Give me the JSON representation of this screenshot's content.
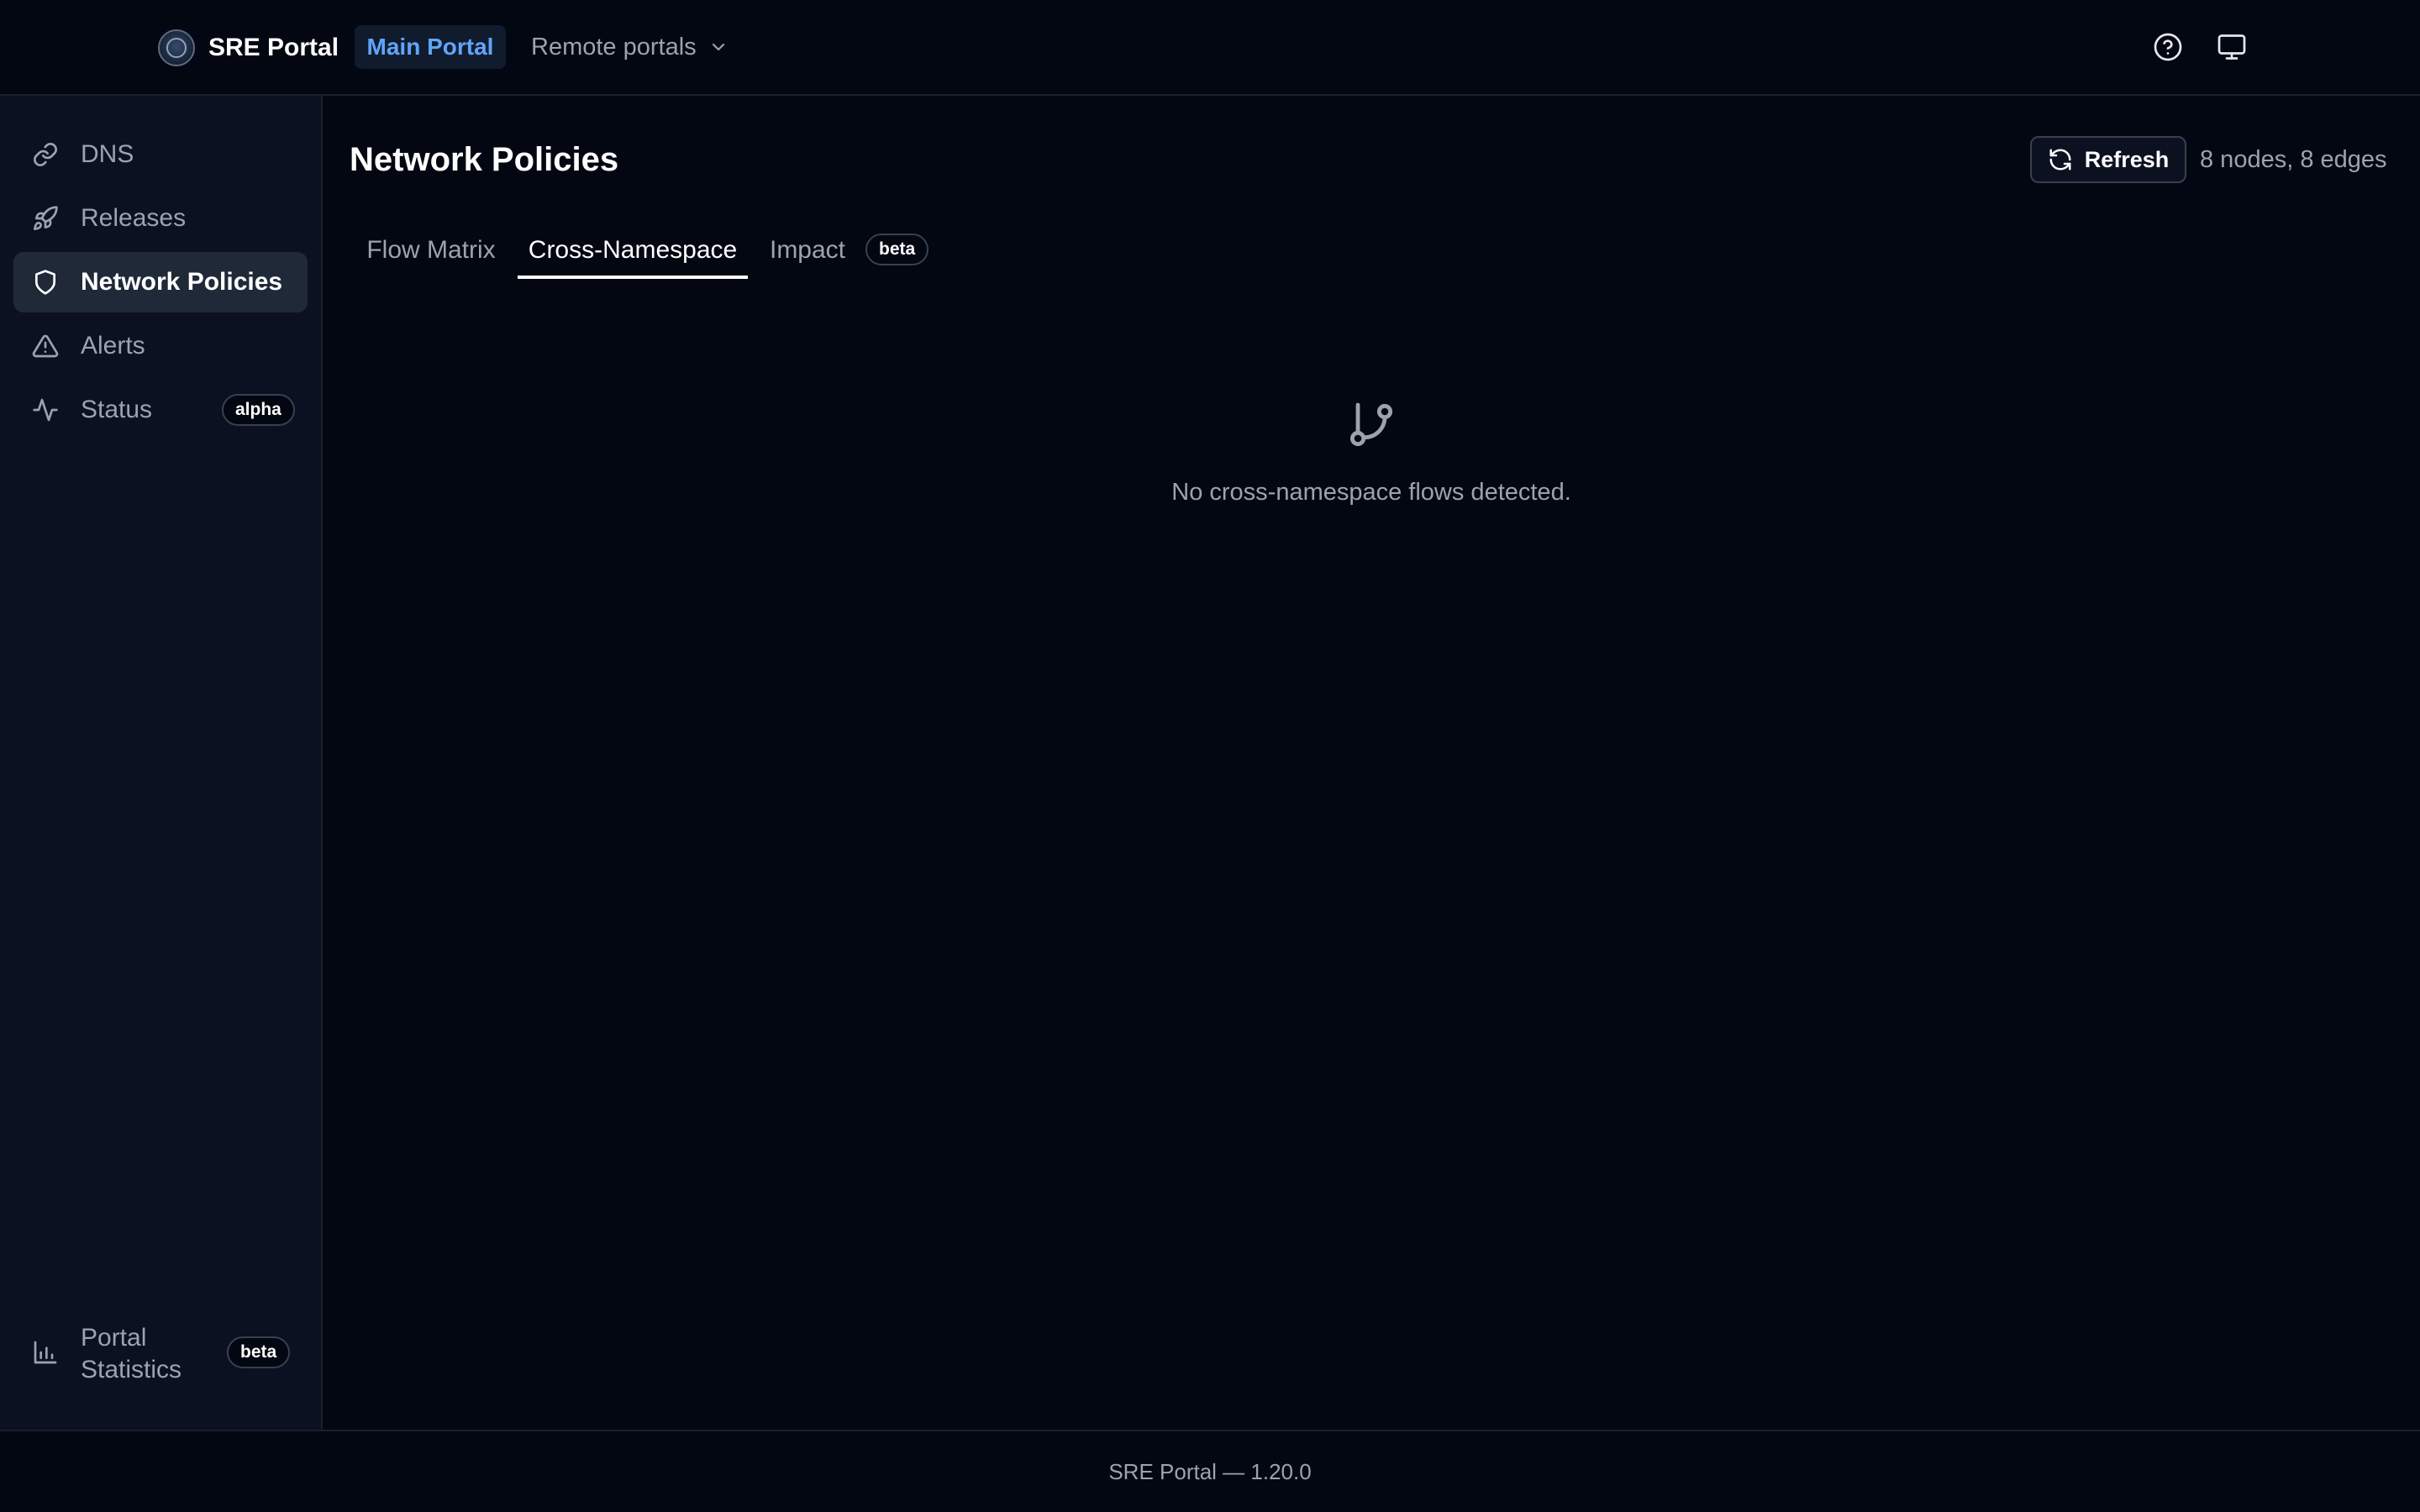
{
  "header": {
    "brand": "SRE Portal",
    "main_portal": "Main Portal",
    "remote_portals": "Remote portals",
    "icons": {
      "logo": "sre-logo",
      "dropdown": "chevron-down-icon",
      "help": "help-circle-icon",
      "display": "monitor-icon"
    }
  },
  "sidebar": {
    "items": [
      {
        "label": "DNS",
        "icon": "link-icon"
      },
      {
        "label": "Releases",
        "icon": "rocket-icon"
      },
      {
        "label": "Network Policies",
        "icon": "shield-icon",
        "active": true
      },
      {
        "label": "Alerts",
        "icon": "alert-triangle-icon"
      },
      {
        "label": "Status",
        "icon": "activity-icon",
        "badge": "alpha"
      }
    ],
    "bottom": {
      "label": "Portal Statistics",
      "icon": "bar-chart-icon",
      "badge": "beta"
    }
  },
  "main": {
    "title": "Network Policies",
    "refresh_label": "Refresh",
    "graph_stats": "8 nodes, 8 edges",
    "tabs": [
      {
        "label": "Flow Matrix"
      },
      {
        "label": "Cross-Namespace",
        "active": true
      },
      {
        "label": "Impact",
        "badge": "beta"
      }
    ],
    "empty_state": {
      "icon": "git-branch-icon",
      "message": "No cross-namespace flows detected."
    }
  },
  "footer": {
    "text": "SRE Portal — 1.20.0"
  },
  "colors": {
    "background": "#030712",
    "sidebar": "#0b1120",
    "accent": "#60a5fa",
    "active_nav": "#1f2937"
  }
}
